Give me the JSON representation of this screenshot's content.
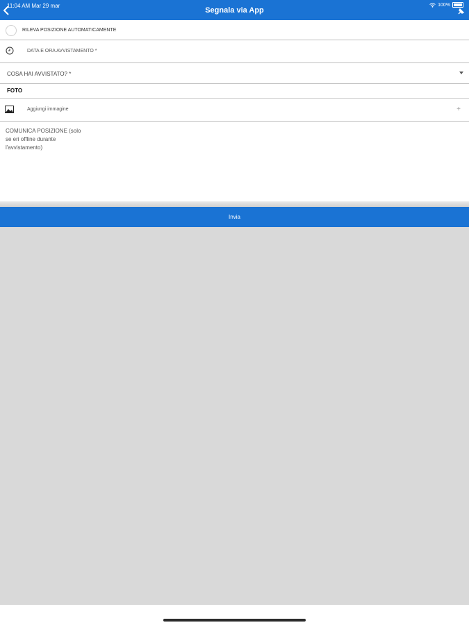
{
  "status_bar": {
    "time": "11:04 AM   Mar 29 mar",
    "battery": "100%"
  },
  "header": {
    "title": "Segnala via App"
  },
  "form": {
    "auto_position_label": "RILEVA POSIZIONE AUTOMATICAMENTE",
    "datetime_label": "DATA E ORA AVVISTAMENTO *",
    "sighting_select_label": "COSA HAI AVVISTATO? *",
    "photo_section_label": "FOTO",
    "add_image_label": "Aggiungi immagine",
    "add_symbol": "+",
    "communicate_position_placeholder": "COMUNICA POSIZIONE (solo\nse eri offline durante\nl'avvistamento)"
  },
  "submit_label": "Invia",
  "colors": {
    "accent": "#1a73d4",
    "background_grey": "#d9d9d9"
  },
  "icons": [
    "back-chevron-icon",
    "wifi-icon",
    "battery-icon",
    "pin-icon",
    "clock-icon",
    "dropdown-arrow-icon",
    "image-icon"
  ]
}
